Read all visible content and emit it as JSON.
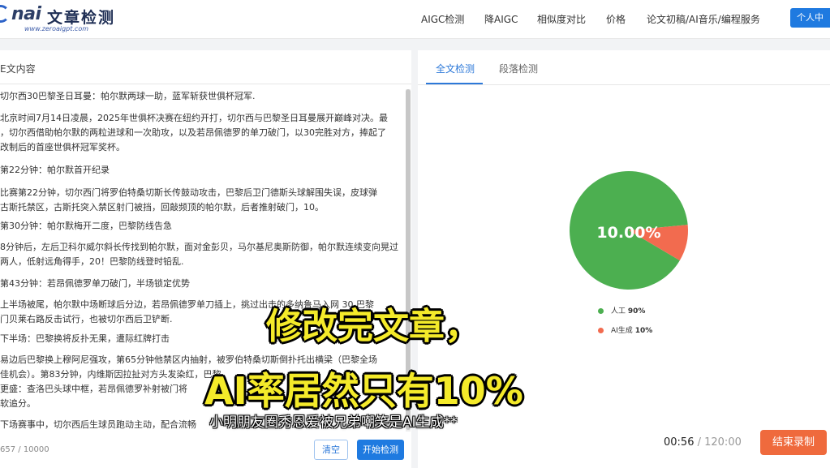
{
  "header": {
    "logo_word": "nai",
    "logo_cn": "文章检测",
    "logo_url": "www.zeroaigpt.com",
    "nav": [
      "AIGC检测",
      "降AIGC",
      "相似度对比",
      "价格",
      "论文初稿/AI音乐/编程服务"
    ],
    "user_button": "个人中"
  },
  "left_panel": {
    "title": "E文内容",
    "lines": [
      "切尔西30巴黎圣日耳曼：帕尔默两球一助，蓝军斩获世俱杯冠军.",
      "北京时间7月14日凌晨，2025年世俱杯决赛在纽约开打，切尔西与巴黎圣日耳曼展开巅峰对决。最",
      "，切尔西借助帕尔默的两粒进球和一次助攻，以及若昂佩德罗的单刀破门，以30完胜对方，捧起了",
      "改制后的首座世俱杯冠军奖杯。",
      "第22分钟：帕尔默首开纪录",
      "比赛第22分钟，切尔西门将罗伯特桑切斯长传鼓动攻击，巴黎后卫门德斯头球解围失误，皮球弹",
      "古斯托禁区，古斯托突入禁区射门被挡，回敲频顶的帕尔默，后者推射破门，10。",
      "第30分钟：帕尔默梅开二度，巴黎防线告急",
      "8分钟后，左后卫科尔威尔斜长传找到帕尔默，面对金彭贝，马尔基尼奥斯防御，帕尔默连续变向晃过",
      "两人，低射远角得手，20！巴黎防线登时铅乱.",
      "第43分钟：若昂佩德罗单刀破门，半场锁定优势",
      "上半场被尾，帕尔默中场断球后分边，若昂佩德罗单刀插上，挑过出击的多纳鲁马入网 30.巴黎",
      "门贝莱右路反击试行，也被切尔西后卫铲断.",
      "下半场：巴黎换将反扑无果，遭际红牌打击",
      "易边后巴黎换上穆阿尼强攻，第65分钟他禁区内抽射，被罗伯特桑切斯倒扑托出横梁（巴黎全场",
      "佳机会）。第83分钟，内维斯因拉扯对方头发染红，巴黎",
      "更盛：查洛巴头球中框，若昂佩德罗补射被门将",
      "软追分。",
      "下场赛事中，切尔西后生球员跑动主动，配合流畅"
    ],
    "char_count": "657 / 10000",
    "clear_button": "清空",
    "start_button": "开始检测"
  },
  "right_panel": {
    "tabs": [
      "全文检测",
      "段落检测"
    ],
    "active_tab": "全文检测"
  },
  "chart_data": {
    "type": "pie",
    "title": "",
    "center_label": "10.00%",
    "series": [
      {
        "name": "人工",
        "value": 90,
        "label": "90%",
        "color": "#4caf50"
      },
      {
        "name": "AI生成",
        "value": 10,
        "label": "10%",
        "color": "#f26b4f"
      }
    ],
    "legend_position": "bottom"
  },
  "overlay": {
    "caption_line1": "修改完文章，",
    "caption_line2": "AI率居然只有10%",
    "subtitle": "小明朋友圈秀恩爱被兄弟嘲笑是AI生成**",
    "timer_elapsed": "00:56",
    "timer_total": "/ 120:00",
    "stop_button": "结束录制"
  }
}
